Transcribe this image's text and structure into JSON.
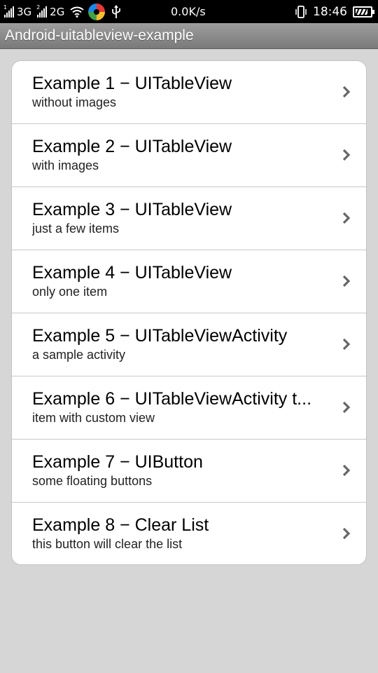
{
  "status_bar": {
    "network_1": "3G",
    "network_2": "2G",
    "network_2_sub": "2",
    "network_1_sub": "1",
    "speed": "0.0K/s",
    "time": "18:46",
    "icons": [
      "signal-icon",
      "signal-icon",
      "wifi-icon",
      "app-logo-icon",
      "usb-icon",
      "vibrate-icon",
      "battery-icon"
    ],
    "battery_level": 0.85
  },
  "title_bar": {
    "title": "Android-uitableview-example"
  },
  "list": {
    "items": [
      {
        "title": "Example 1 − UITableView",
        "subtitle": "without images"
      },
      {
        "title": "Example 2 − UITableView",
        "subtitle": "with images"
      },
      {
        "title": "Example 3 − UITableView",
        "subtitle": "just a few items"
      },
      {
        "title": "Example 4 − UITableView",
        "subtitle": "only one item"
      },
      {
        "title": "Example 5 − UITableViewActivity",
        "subtitle": "a sample activity"
      },
      {
        "title": "Example 6 − UITableViewActivity t...",
        "subtitle": "item with custom view"
      },
      {
        "title": "Example 7 − UIButton",
        "subtitle": "some floating buttons"
      },
      {
        "title": "Example 8 − Clear List",
        "subtitle": "this button will clear the list"
      }
    ]
  },
  "colors": {
    "background": "#d6d6d6",
    "status_bar": "#000000",
    "title_bar": "#8a8a8a",
    "card": "#ffffff",
    "chevron": "#666666"
  }
}
